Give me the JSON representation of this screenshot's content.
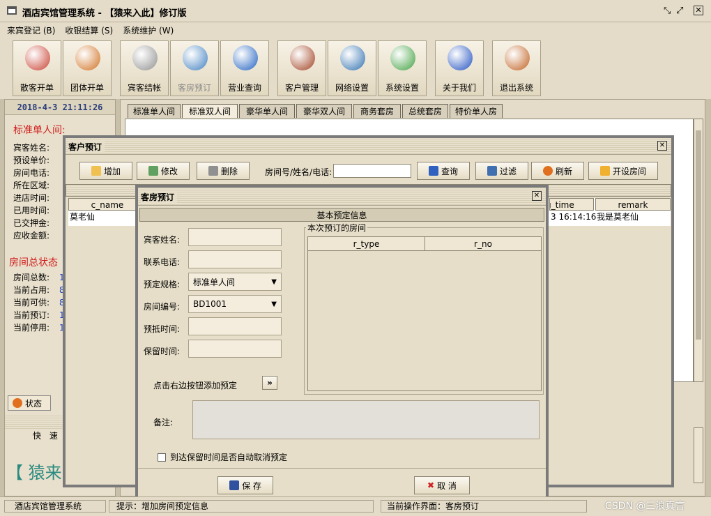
{
  "app": {
    "title": "酒店宾馆管理系统 - 【猿来入此】修订版"
  },
  "menu": [
    "来宾登记 (B)",
    "收银结算 (S)",
    "系统维护 (W)"
  ],
  "toolbar": [
    {
      "label": "散客开单",
      "icon": "guest-person-icon",
      "color": "#c84030"
    },
    {
      "label": "团体开单",
      "icon": "group-people-icon",
      "color": "#d07020"
    },
    {
      "label": "宾客结帐",
      "icon": "computer-icon",
      "color": "#909090"
    },
    {
      "label": "客房预订",
      "icon": "compass-icon",
      "color": "#4080c0"
    },
    {
      "label": "营业查询",
      "icon": "magnifier-icon",
      "color": "#2060c0"
    },
    {
      "label": "客户管理",
      "icon": "customer-icon",
      "color": "#a04020"
    },
    {
      "label": "网络设置",
      "icon": "network-icon",
      "color": "#3070b0"
    },
    {
      "label": "系统设置",
      "icon": "tools-icon",
      "color": "#40a040"
    },
    {
      "label": "关于我们",
      "icon": "about-icon",
      "color": "#2050c0"
    },
    {
      "label": "退出系统",
      "icon": "exit-door-icon",
      "color": "#c06020"
    }
  ],
  "left_panel": {
    "datetime": "2018-4-3  21:11:26",
    "room_title": "标准单人间:",
    "fields": [
      "宾客姓名:",
      "预设单价:",
      "房间电话:",
      "所在区域:",
      "进店时间:",
      "已用时间:",
      "已交押金:",
      "应收金额:"
    ],
    "status_title": "房间总状态",
    "stats": [
      {
        "label": "房间总数:",
        "value": "1"
      },
      {
        "label": "当前占用:",
        "value": "8"
      },
      {
        "label": "当前可供:",
        "value": "8"
      },
      {
        "label": "当前预订:",
        "value": "1"
      },
      {
        "label": "当前停用:",
        "value": "1"
      }
    ],
    "tab_state": "状态",
    "quick_label": "快 速",
    "brand": "【 猿来"
  },
  "room_tabs": [
    "标准单人间",
    "标准双人间",
    "豪华单人间",
    "豪华双人间",
    "商务套房",
    "总统套房",
    "特价单人房"
  ],
  "customer_dialog": {
    "title": "客户预订",
    "buttons": {
      "add": "增加",
      "edit": "修改",
      "delete": "删除",
      "query": "查询",
      "filter": "过滤",
      "refresh": "刷新",
      "open_room": "开设房间"
    },
    "search_label": "房间号/姓名/电话:",
    "search_value": "",
    "columns": [
      "c_name",
      "g_time",
      "remark"
    ],
    "row": [
      "莫老仙",
      "3 16:14:16",
      "我是莫老仙"
    ]
  },
  "booking_dialog": {
    "title": "客房预订",
    "section_title": "基本预定信息",
    "labels": {
      "name": "宾客姓名:",
      "phone": "联系电话:",
      "spec": "预定规格:",
      "room_no": "房间编号:",
      "arrive": "预抵时间:",
      "keep": "保留时间:"
    },
    "values": {
      "name": "",
      "phone": "",
      "spec": "标准单人间",
      "room_no": "BD1001",
      "arrive": "",
      "keep": ""
    },
    "rooms_group": "本次预订的房间",
    "rooms_columns": [
      "r_type",
      "r_no"
    ],
    "add_hint": "点击右边按钮添加预定",
    "add_button": "»",
    "remark_label": "备注:",
    "remark_value": "",
    "auto_cancel": "到达保留时间是否自动取消预定",
    "save": "保 存",
    "cancel": "取 消"
  },
  "statusbar": {
    "app": "酒店宾馆管理系统",
    "hint": "提示：增加房间预定信息",
    "current": "当前操作界面：客房预订"
  },
  "watermark": "CSDN @三浪真言"
}
